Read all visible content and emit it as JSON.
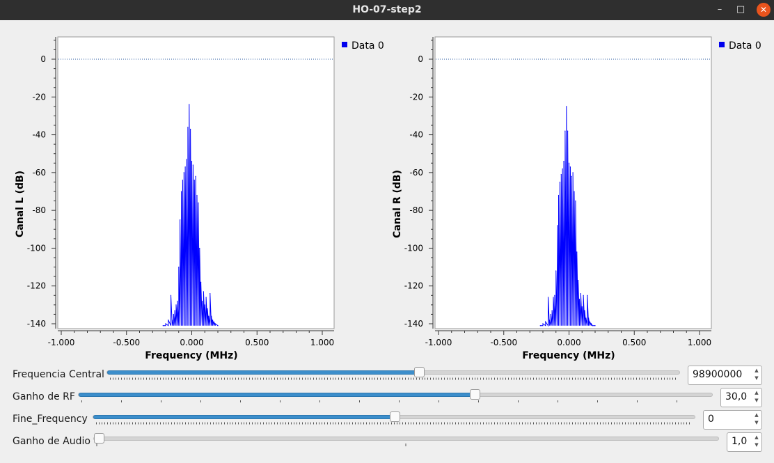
{
  "window": {
    "title": "HO-07-step2",
    "minimize": "–",
    "maximize": "□",
    "close": "✕"
  },
  "charts": [
    {
      "ylabel": "Canal L (dB)",
      "xlabel": "Frequency (MHz)",
      "legend": "Data 0",
      "yticks": [
        "0",
        "-20",
        "-40",
        "-60",
        "-80",
        "-100",
        "-120",
        "-140"
      ],
      "xticks": [
        "-1.000",
        "-0.500",
        "0.000",
        "0.500",
        "1.000"
      ]
    },
    {
      "ylabel": "Canal R (dB)",
      "xlabel": "Frequency (MHz)",
      "legend": "Data 0",
      "yticks": [
        "0",
        "-20",
        "-40",
        "-60",
        "-80",
        "-100",
        "-120",
        "-140"
      ],
      "xticks": [
        "-1.000",
        "-0.500",
        "0.000",
        "0.500",
        "1.000"
      ]
    }
  ],
  "chart_data": [
    {
      "type": "line",
      "xlabel": "Frequency (MHz)",
      "ylabel": "Canal L (dB)",
      "xlim": [
        -1.0,
        1.1
      ],
      "ylim": [
        -142,
        12
      ],
      "legend_position": "top-right",
      "grid": false,
      "series_color": "#0000ff",
      "reference_line": 0,
      "series": [
        {
          "name": "Data 0",
          "x": [
            -0.22,
            -0.2,
            -0.18,
            -0.16,
            -0.15,
            -0.14,
            -0.13,
            -0.12,
            -0.11,
            -0.1,
            -0.09,
            -0.08,
            -0.07,
            -0.06,
            -0.05,
            -0.04,
            -0.03,
            -0.02,
            -0.01,
            0.0,
            0.01,
            0.02,
            0.03,
            0.04,
            0.05,
            0.06,
            0.07,
            0.08,
            0.09,
            0.1,
            0.11,
            0.12,
            0.13,
            0.14,
            0.15,
            0.16,
            0.17,
            0.18,
            0.2
          ],
          "y": [
            -141,
            -140,
            -138,
            -125,
            -138,
            -135,
            -133,
            -130,
            -128,
            -110,
            -85,
            -70,
            -64,
            -60,
            -57,
            -53,
            -36,
            -24,
            -37,
            -54,
            -56,
            -64,
            -62,
            -72,
            -76,
            -100,
            -118,
            -128,
            -123,
            -130,
            -126,
            -132,
            -136,
            -124,
            -136,
            -138,
            -139,
            -140,
            -141
          ]
        }
      ]
    },
    {
      "type": "line",
      "xlabel": "Frequency (MHz)",
      "ylabel": "Canal R (dB)",
      "xlim": [
        -1.0,
        1.1
      ],
      "ylim": [
        -142,
        12
      ],
      "legend_position": "top-right",
      "grid": false,
      "series_color": "#0000ff",
      "reference_line": 0,
      "series": [
        {
          "name": "Data 0",
          "x": [
            -0.22,
            -0.2,
            -0.18,
            -0.16,
            -0.15,
            -0.14,
            -0.13,
            -0.12,
            -0.11,
            -0.1,
            -0.09,
            -0.08,
            -0.07,
            -0.06,
            -0.05,
            -0.04,
            -0.03,
            -0.02,
            -0.01,
            0.0,
            0.01,
            0.02,
            0.03,
            0.04,
            0.05,
            0.06,
            0.07,
            0.08,
            0.09,
            0.1,
            0.11,
            0.12,
            0.13,
            0.14,
            0.15,
            0.16,
            0.17,
            0.18,
            0.2
          ],
          "y": [
            -141,
            -140,
            -139,
            -126,
            -138,
            -135,
            -133,
            -126,
            -125,
            -112,
            -88,
            -72,
            -65,
            -61,
            -58,
            -54,
            -38,
            -25,
            -38,
            -55,
            -57,
            -62,
            -60,
            -70,
            -75,
            -102,
            -117,
            -127,
            -124,
            -131,
            -125,
            -133,
            -137,
            -125,
            -137,
            -139,
            -140,
            -141,
            -141
          ]
        }
      ]
    }
  ],
  "controls": [
    {
      "label": "Frequencia Central",
      "value": "98900000",
      "fraction": 0.543
    },
    {
      "label": "Ganho de RF",
      "value": "30,0",
      "fraction": 0.623
    },
    {
      "label": "Fine_Frequency",
      "value": "0",
      "fraction": 0.5
    },
    {
      "label": "Ganho de Audio",
      "value": "1,0",
      "fraction": 0.0
    }
  ]
}
